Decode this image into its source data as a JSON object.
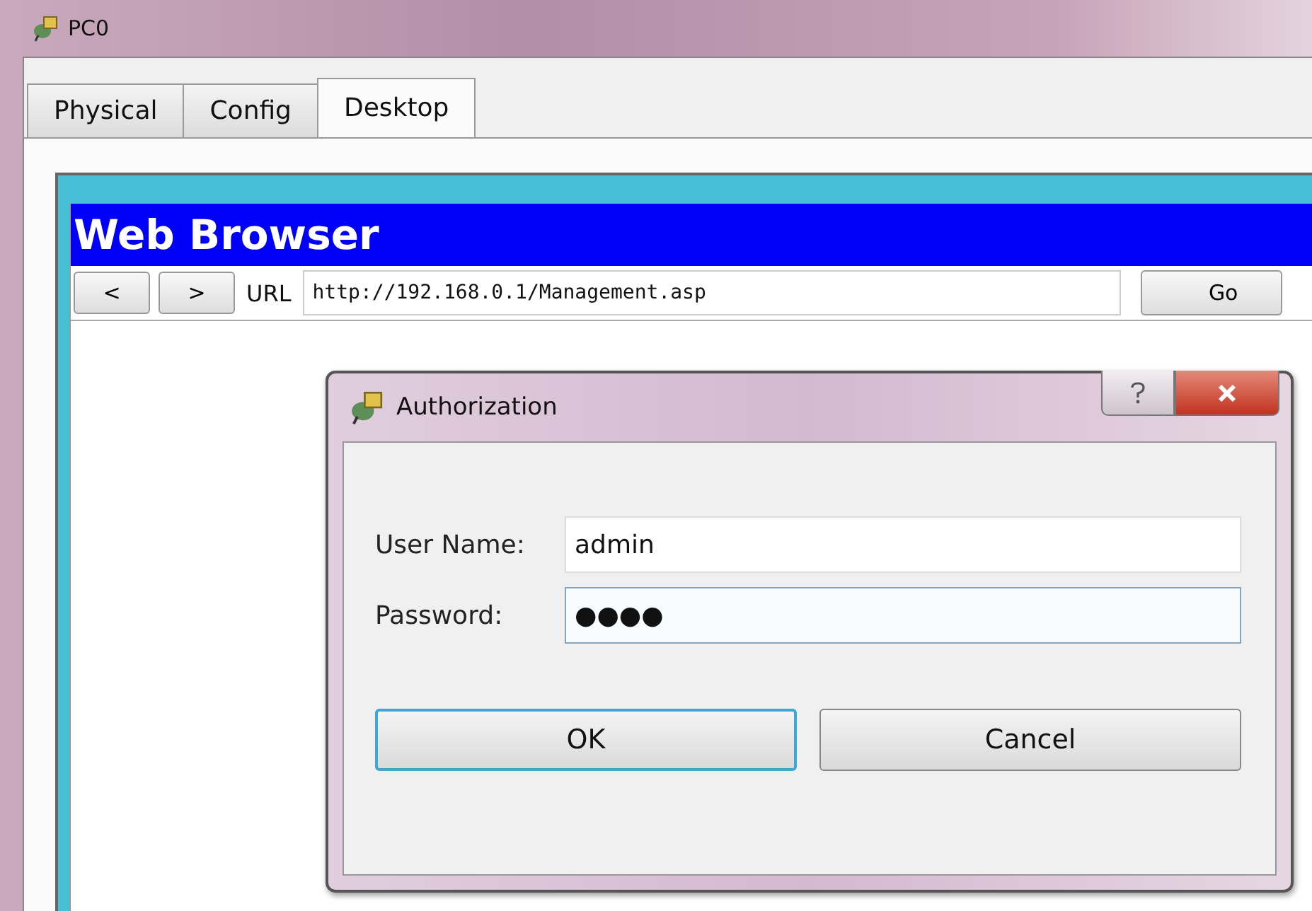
{
  "window": {
    "title": "PC0"
  },
  "tabs": [
    {
      "label": "Physical",
      "selected": false
    },
    {
      "label": "Config",
      "selected": false
    },
    {
      "label": "Desktop",
      "selected": true
    }
  ],
  "browser": {
    "title": "Web Browser",
    "back": "<",
    "forward": ">",
    "url_label": "URL",
    "url": "http://192.168.0.1/Management.asp",
    "go": "Go"
  },
  "dialog": {
    "title": "Authorization",
    "fields": [
      {
        "label": "User Name:",
        "value": "admin",
        "focused": false
      },
      {
        "label": "Password:",
        "value": "●●●●",
        "focused": true
      }
    ],
    "buttons": [
      {
        "label": "OK",
        "default": true
      },
      {
        "label": "Cancel",
        "default": false
      }
    ]
  }
}
